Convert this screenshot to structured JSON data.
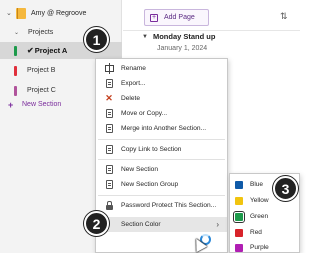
{
  "nav": {
    "notebook": {
      "name": "Amy @ Regroove",
      "color": "#f5b83d"
    },
    "section_group": "Projects",
    "sections": [
      {
        "label": "Project A",
        "color": "#1d9a4b",
        "selected": true
      },
      {
        "label": "Project B",
        "color": "#e0303c",
        "selected": false
      },
      {
        "label": "Project C",
        "color": "#b0539b",
        "selected": false
      }
    ],
    "new_section_label": "New Section"
  },
  "pages": {
    "add_page_label": "Add Page",
    "heading": "Monday Stand up",
    "date": "January 1, 2024"
  },
  "context_menu": {
    "items": [
      {
        "label": "Rename",
        "icon": "rename-icon"
      },
      {
        "label": "Export...",
        "icon": "export-icon"
      },
      {
        "label": "Delete",
        "icon": "delete-icon"
      },
      {
        "label": "Move or Copy...",
        "icon": "move-copy-icon"
      },
      {
        "label": "Merge into Another Section...",
        "icon": "merge-icon"
      },
      {
        "label": "Copy Link to Section",
        "icon": "copy-link-icon"
      },
      {
        "label": "New Section",
        "icon": "new-section-icon"
      },
      {
        "label": "New Section Group",
        "icon": "new-section-group-icon"
      },
      {
        "label": "Password Protect This Section...",
        "icon": "lock-icon"
      },
      {
        "label": "Section Color",
        "icon": "",
        "has_submenu": true
      }
    ]
  },
  "color_submenu": {
    "items": [
      {
        "label": "Blue",
        "color": "#0f5aa8"
      },
      {
        "label": "Yellow",
        "color": "#f1c40f"
      },
      {
        "label": "Green",
        "color": "#1d9a4b",
        "selected": true
      },
      {
        "label": "Red",
        "color": "#d8232a"
      },
      {
        "label": "Purple",
        "color": "#b01fb3"
      }
    ]
  },
  "callouts": [
    "1",
    "2",
    "3"
  ]
}
